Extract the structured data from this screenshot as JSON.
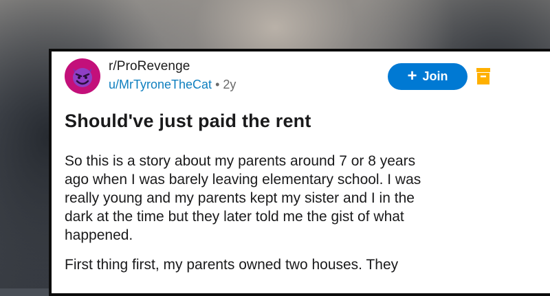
{
  "post": {
    "subreddit": "r/ProRevenge",
    "username": "u/MrTyroneTheCat",
    "separator": "•",
    "age": "2y",
    "join_label": "Join",
    "join_icon": "plus-icon",
    "save_icon": "bookmark-icon",
    "avatar_icon": "devil-face-icon",
    "title": "Should've just paid the rent",
    "paragraph1_lines": [
      "So this is a story about my parents around 7 or 8 years",
      "ago when I was barely leaving elementary school. I was",
      "really young and my parents kept my sister and I in the",
      "dark at the time but they later told me the gist of what",
      "happened."
    ],
    "paragraph2_lines": [
      "First thing first, my parents owned two houses. They"
    ]
  },
  "colors": {
    "accent": "#0079d3",
    "avatar_bg": "#c3107a",
    "username": "#0f7fbf",
    "save_icon": "#ffb000"
  }
}
